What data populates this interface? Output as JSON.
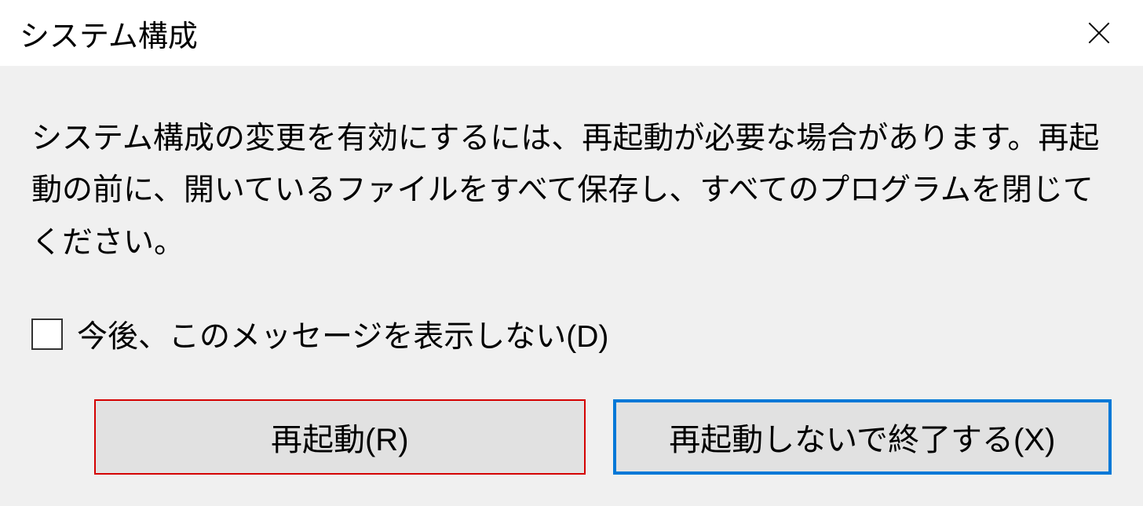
{
  "dialog": {
    "title": "システム構成",
    "message": "システム構成の変更を有効にするには、再起動が必要な場合があります。再起動の前に、開いているファイルをすべて保存し、すべてのプログラムを閉じてください。",
    "checkbox_label": "今後、このメッセージを表示しない(D)",
    "checkbox_checked": false,
    "buttons": {
      "restart": "再起動(R)",
      "exit": "再起動しないで終了する(X)"
    }
  }
}
